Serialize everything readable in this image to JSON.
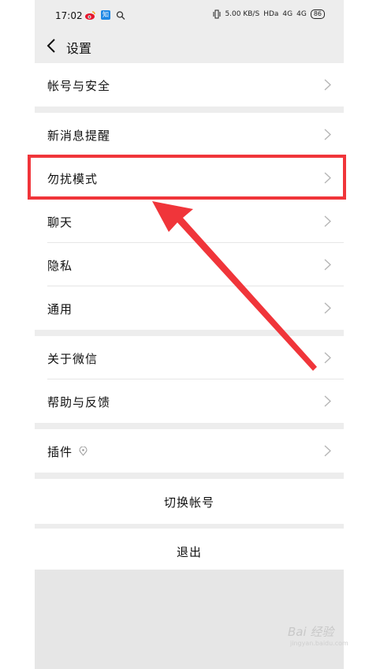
{
  "status_bar": {
    "time": "17:02",
    "zhihu_text": "知",
    "network": "5.00 KB/S",
    "hd": "HDa",
    "signal1": "4G",
    "signal2": "4G",
    "battery": "86"
  },
  "header": {
    "title": "设置"
  },
  "settings": {
    "account_security": "帐号与安全",
    "new_message_alerts": "新消息提醒",
    "do_not_disturb": "勿扰模式",
    "chat": "聊天",
    "privacy": "隐私",
    "general": "通用",
    "about_wechat": "关于微信",
    "help_feedback": "帮助与反馈",
    "plugins": "插件",
    "switch_account": "切换帐号",
    "logout": "退出"
  },
  "watermark": {
    "text": "Bai 经验",
    "sub": "jingyan.baidu.com"
  },
  "annotation_color": "#f0353a"
}
